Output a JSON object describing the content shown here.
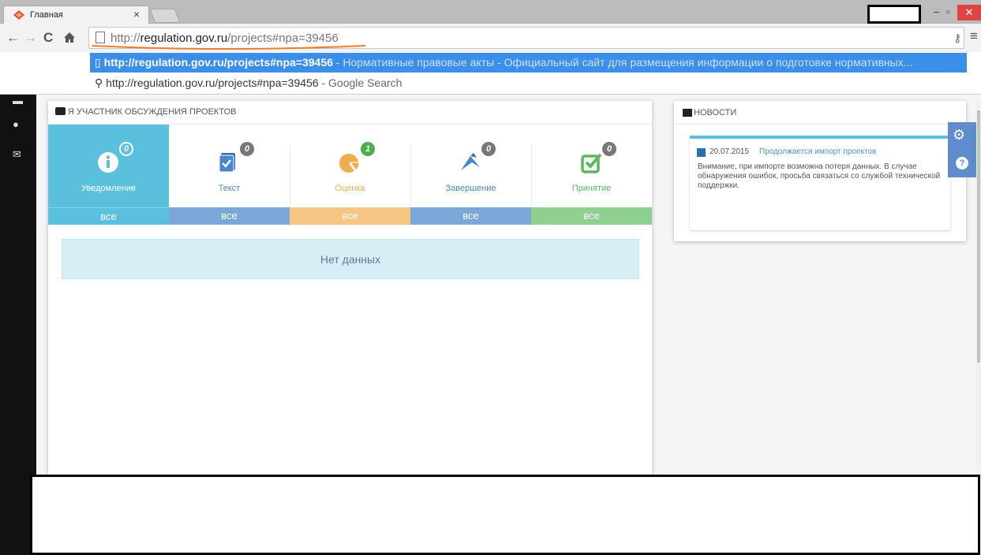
{
  "browser": {
    "tab_title": "Главная",
    "tab_close": "×",
    "omnibox": {
      "scheme": "http://",
      "host": "regulation.gov.ru",
      "path": "/projects#npa=39456"
    },
    "suggestions": [
      {
        "url": "http://regulation.gov.ru/projects#npa=39456",
        "desc": " - Нормативные правовые акты - Официальный сайт для размещения информации о подготовке нормативных..."
      },
      {
        "url": "http://regulation.gov.ru/projects#npa=39456",
        "desc": " - Google Search"
      }
    ],
    "icons": {
      "back": "back-arrow-icon",
      "forward": "forward-arrow-icon",
      "reload": "reload-icon",
      "home": "home-icon",
      "menu": "hamburger-menu-icon"
    },
    "accent_color": "#3b8fe9",
    "annotation_color": "#f07a2a"
  },
  "main": {
    "header": "Я УЧАСТНИК ОБСУЖДЕНИЯ ПРОЕКТОВ",
    "stages": [
      {
        "label": "Уведомление",
        "count": "0",
        "all": "все",
        "color": "#5bc0de",
        "icon": "info-icon"
      },
      {
        "label": "Текст",
        "count": "0",
        "all": "все",
        "color": "#4a86c8",
        "icon": "document-check-icon"
      },
      {
        "label": "Оценка",
        "count": "1",
        "all": "все",
        "color": "#f0ad4e",
        "icon": "pie-chart-icon"
      },
      {
        "label": "Завершение",
        "count": "0",
        "all": "все",
        "color": "#4a86c8",
        "icon": "flag-icon"
      },
      {
        "label": "Принятие",
        "count": "0",
        "all": "все",
        "color": "#5cb85c",
        "icon": "checkbox-icon"
      }
    ],
    "no_data": "Нет данных"
  },
  "news": {
    "header": "НОВОСТИ",
    "items": [
      {
        "date": "20.07.2015",
        "title": "Продолжается импорт проектов",
        "text": "Внимание, при импорте возможна потеря данных. В случае обнаружения ошибок, просьба связаться со службой технической поддержки."
      }
    ]
  },
  "side_widget": {
    "help": "?"
  }
}
